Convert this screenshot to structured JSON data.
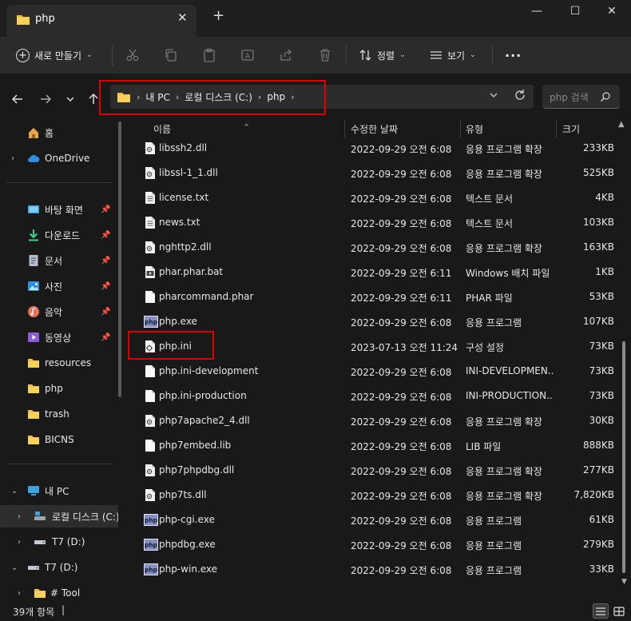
{
  "window": {
    "tab_title": "php",
    "new_tab": "+",
    "minimize": "—",
    "maximize": "☐",
    "close": "✕"
  },
  "toolbar": {
    "new_label": "새로 만들기",
    "sort_label": "정렬",
    "view_label": "보기",
    "more_label": "···"
  },
  "address": {
    "crumbs": [
      "내 PC",
      "로컬 디스크 (C:)",
      "php"
    ],
    "search_placeholder": "php 검색"
  },
  "columns": {
    "name": "이름",
    "date": "수정한 날짜",
    "type": "유형",
    "size": "크기"
  },
  "sidebar": {
    "items": [
      {
        "label": "홈",
        "icon": "home-icon"
      },
      {
        "label": "OneDrive",
        "icon": "cloud-icon"
      },
      {
        "label": "바탕 화면",
        "icon": "desktop-icon"
      },
      {
        "label": "다운로드",
        "icon": "download-icon"
      },
      {
        "label": "문서",
        "icon": "document-icon"
      },
      {
        "label": "사진",
        "icon": "pictures-icon"
      },
      {
        "label": "음악",
        "icon": "music-icon"
      },
      {
        "label": "동영상",
        "icon": "video-icon"
      },
      {
        "label": "resources",
        "icon": "folder-icon"
      },
      {
        "label": "php",
        "icon": "folder-icon"
      },
      {
        "label": "trash",
        "icon": "folder-icon"
      },
      {
        "label": "BICNS",
        "icon": "folder-icon"
      },
      {
        "label": "내 PC",
        "icon": "pc-icon"
      },
      {
        "label": "로컬 디스크 (C:)",
        "icon": "local-disk-icon"
      },
      {
        "label": "T7 (D:)",
        "icon": "drive-icon"
      },
      {
        "label": "T7 (D:)",
        "icon": "drive-icon"
      },
      {
        "label": "# Tool",
        "icon": "folder-icon"
      }
    ]
  },
  "files": [
    {
      "name": "libssh2.dll",
      "date": "2022-09-29 오전 6:08",
      "type": "응용 프로그램 확장",
      "size": "233KB",
      "icon": "dll"
    },
    {
      "name": "libssl-1_1.dll",
      "date": "2022-09-29 오전 6:08",
      "type": "응용 프로그램 확장",
      "size": "525KB",
      "icon": "dll"
    },
    {
      "name": "license.txt",
      "date": "2022-09-29 오전 6:08",
      "type": "텍스트 문서",
      "size": "4KB",
      "icon": "txt"
    },
    {
      "name": "news.txt",
      "date": "2022-09-29 오전 6:08",
      "type": "텍스트 문서",
      "size": "103KB",
      "icon": "txt"
    },
    {
      "name": "nghttp2.dll",
      "date": "2022-09-29 오전 6:08",
      "type": "응용 프로그램 확장",
      "size": "163KB",
      "icon": "dll"
    },
    {
      "name": "phar.phar.bat",
      "date": "2022-09-29 오전 6:11",
      "type": "Windows 배치 파일",
      "size": "1KB",
      "icon": "bat"
    },
    {
      "name": "pharcommand.phar",
      "date": "2022-09-29 오전 6:11",
      "type": "PHAR 파일",
      "size": "53KB",
      "icon": "blank"
    },
    {
      "name": "php.exe",
      "date": "2022-09-29 오전 6:08",
      "type": "응용 프로그램",
      "size": "107KB",
      "icon": "php"
    },
    {
      "name": "php.ini",
      "date": "2023-07-13 오전 11:24",
      "type": "구성 설정",
      "size": "73KB",
      "icon": "ini"
    },
    {
      "name": "php.ini-development",
      "date": "2022-09-29 오전 6:08",
      "type": "INI-DEVELOPMEN...",
      "size": "73KB",
      "icon": "blank"
    },
    {
      "name": "php.ini-production",
      "date": "2022-09-29 오전 6:08",
      "type": "INI-PRODUCTION...",
      "size": "73KB",
      "icon": "blank"
    },
    {
      "name": "php7apache2_4.dll",
      "date": "2022-09-29 오전 6:08",
      "type": "응용 프로그램 확장",
      "size": "30KB",
      "icon": "dll"
    },
    {
      "name": "php7embed.lib",
      "date": "2022-09-29 오전 6:08",
      "type": "LIB 파일",
      "size": "888KB",
      "icon": "blank"
    },
    {
      "name": "php7phpdbg.dll",
      "date": "2022-09-29 오전 6:08",
      "type": "응용 프로그램 확장",
      "size": "277KB",
      "icon": "dll"
    },
    {
      "name": "php7ts.dll",
      "date": "2022-09-29 오전 6:08",
      "type": "응용 프로그램 확장",
      "size": "7,820KB",
      "icon": "dll"
    },
    {
      "name": "php-cgi.exe",
      "date": "2022-09-29 오전 6:08",
      "type": "응용 프로그램",
      "size": "61KB",
      "icon": "php"
    },
    {
      "name": "phpdbg.exe",
      "date": "2022-09-29 오전 6:08",
      "type": "응용 프로그램",
      "size": "279KB",
      "icon": "php"
    },
    {
      "name": "php-win.exe",
      "date": "2022-09-29 오전 6:08",
      "type": "응용 프로그램",
      "size": "33KB",
      "icon": "php"
    }
  ],
  "status": {
    "item_count": "39개 항목",
    "caret": "|"
  },
  "colors": {
    "highlight_border": "#e00000",
    "folder": "#f3c13a",
    "accent": "#4aa0e6"
  }
}
